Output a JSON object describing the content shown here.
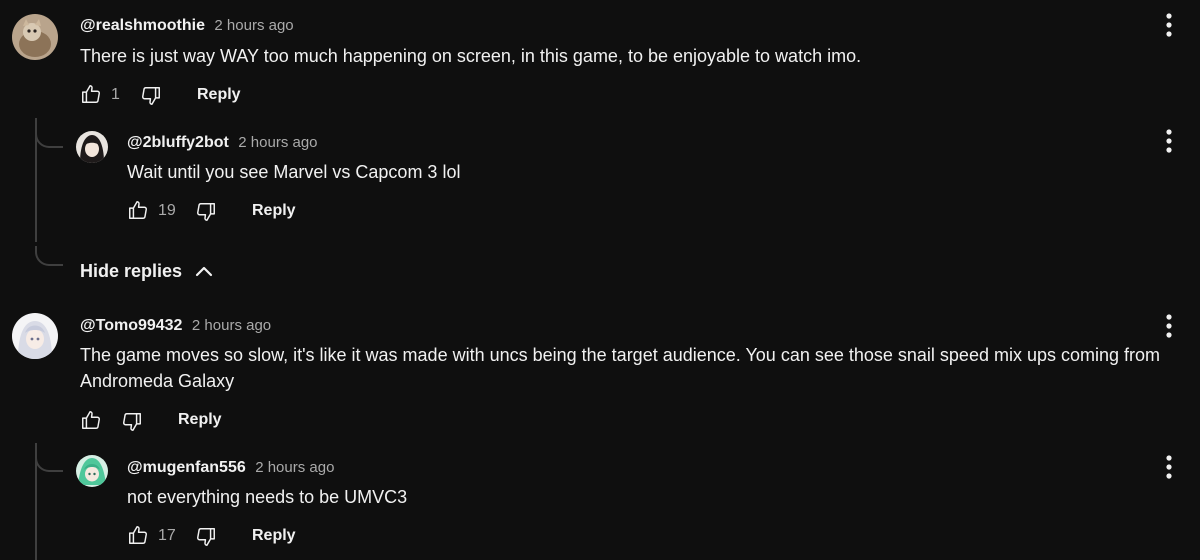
{
  "comments": [
    {
      "handle": "@realshmoothie",
      "time": "2 hours ago",
      "text": "There is just way WAY too much happening on screen, in this game, to be enjoyable to watch imo.",
      "likes": "1",
      "reply_label": "Reply",
      "avatar_icon": "cat-avatar",
      "replies": [
        {
          "handle": "@2bluffy2bot",
          "time": "2 hours ago",
          "text": "Wait until you see Marvel vs Capcom 3 lol",
          "likes": "19",
          "reply_label": "Reply",
          "avatar_icon": "anime-girl-avatar"
        }
      ],
      "hide_replies_label": "Hide replies"
    },
    {
      "handle": "@Tomo99432",
      "time": "2 hours ago",
      "text": "The game moves so slow, it's like it was made with uncs being the target audience. You can see those snail speed mix ups coming from Andromeda Galaxy",
      "likes": "",
      "reply_label": "Reply",
      "avatar_icon": "white-hair-avatar",
      "replies": [
        {
          "handle": "@mugenfan556",
          "time": "2 hours ago",
          "text": "not everything needs to be UMVC3",
          "likes": "17",
          "reply_label": "Reply",
          "avatar_icon": "green-hair-avatar"
        }
      ]
    }
  ],
  "colors": {
    "background": "#0f0f0f",
    "text": "#f1f1f1",
    "secondary_text": "#aaaaaa",
    "thread_line": "#3f3f3f"
  }
}
